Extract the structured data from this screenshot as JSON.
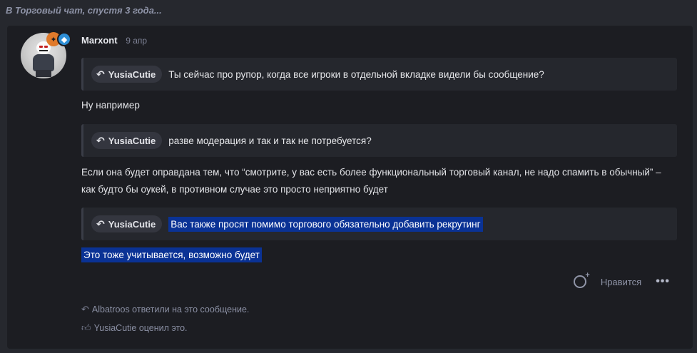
{
  "topic_header": "В Торговый чат, спустя 3 года...",
  "post": {
    "author": "Marxont",
    "date": "9 апр",
    "avatar_badges": [
      "orange-badge-icon",
      "diamond-icon"
    ],
    "quotes": [
      {
        "user": "YusiaCutie",
        "text": "Ты сейчас про рупор, когда все игроки в отдельной вкладке видели бы сообщение?"
      },
      {
        "user": "YusiaCutie",
        "text": "разве модерация и так и так не потребуется?"
      },
      {
        "user": "YusiaCutie",
        "text": "Вас также просят помимо торгового обязательно добавить рекрутинг"
      }
    ],
    "paragraphs": {
      "p1": "Ну например",
      "p2_line1": "Если она будет оправдана тем, что “смотрите, у вас есть более функциональный торговый канал, не надо спамить в обычный” –",
      "p2_line2": "как будто бы оукей, в противном случае это просто неприятно будет",
      "p3": "Это тоже учитывается, возможно будет"
    },
    "actions": {
      "like_label": "Нравится"
    },
    "meta": {
      "replied": "Albatroos ответили на это сообщение.",
      "reacted": "YusiaCutie оценил это."
    }
  },
  "colors": {
    "page_bg": "#26282e",
    "post_bg": "#1c1d22",
    "quote_bg": "#25272d",
    "highlight": "#0a3295",
    "muted": "#8e93a7"
  }
}
